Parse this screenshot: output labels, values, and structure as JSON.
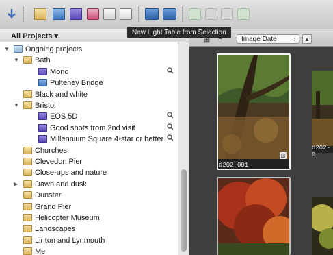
{
  "tooltip": "New Light Table from Selection",
  "library": {
    "header": "All Projects ▾",
    "items": [
      {
        "label": "Ongoing projects",
        "indent": 0,
        "tri": "▼",
        "icon": "folder-blue"
      },
      {
        "label": "Bath",
        "indent": 1,
        "tri": "▼",
        "icon": "folder"
      },
      {
        "label": "Mono",
        "indent": 2,
        "tri": "",
        "icon": "smart",
        "search": true
      },
      {
        "label": "Pulteney Bridge",
        "indent": 2,
        "tri": "",
        "icon": "album"
      },
      {
        "label": "Black and white",
        "indent": 1,
        "tri": "",
        "icon": "folder"
      },
      {
        "label": "Bristol",
        "indent": 1,
        "tri": "▼",
        "icon": "folder"
      },
      {
        "label": "EOS 5D",
        "indent": 2,
        "tri": "",
        "icon": "smart",
        "search": true
      },
      {
        "label": "Good shots from 2nd visit",
        "indent": 2,
        "tri": "",
        "icon": "smart",
        "search": true
      },
      {
        "label": "Millennium Square 4-star or better",
        "indent": 2,
        "tri": "",
        "icon": "smart",
        "search": true
      },
      {
        "label": "Churches",
        "indent": 1,
        "tri": "",
        "icon": "folder"
      },
      {
        "label": "Clevedon Pier",
        "indent": 1,
        "tri": "",
        "icon": "folder"
      },
      {
        "label": "Close-ups and nature",
        "indent": 1,
        "tri": "",
        "icon": "folder"
      },
      {
        "label": "Dawn and dusk",
        "indent": 1,
        "tri": "▶",
        "icon": "folder"
      },
      {
        "label": "Dunster",
        "indent": 1,
        "tri": "",
        "icon": "folder"
      },
      {
        "label": "Grand Pier",
        "indent": 1,
        "tri": "",
        "icon": "folder"
      },
      {
        "label": "Helicopter Museum",
        "indent": 1,
        "tri": "",
        "icon": "folder"
      },
      {
        "label": "Landscapes",
        "indent": 1,
        "tri": "",
        "icon": "folder"
      },
      {
        "label": "Linton and Lynmouth",
        "indent": 1,
        "tri": "",
        "icon": "folder"
      },
      {
        "label": "Me",
        "indent": 1,
        "tri": "",
        "icon": "folder"
      }
    ],
    "search_glyph": "🔍"
  },
  "browser": {
    "sort_label": "Image Date",
    "sort_arrow": "↕",
    "direction_glyph": "▲",
    "grid_glyph": "▦",
    "list_glyph": "≡",
    "captions": [
      "d202-001",
      "d202-0"
    ]
  },
  "colors": {
    "accent": "#4a7fc1",
    "tooltip_bg": "#2a2a2a",
    "browser_bg": "#3e3e3e"
  }
}
